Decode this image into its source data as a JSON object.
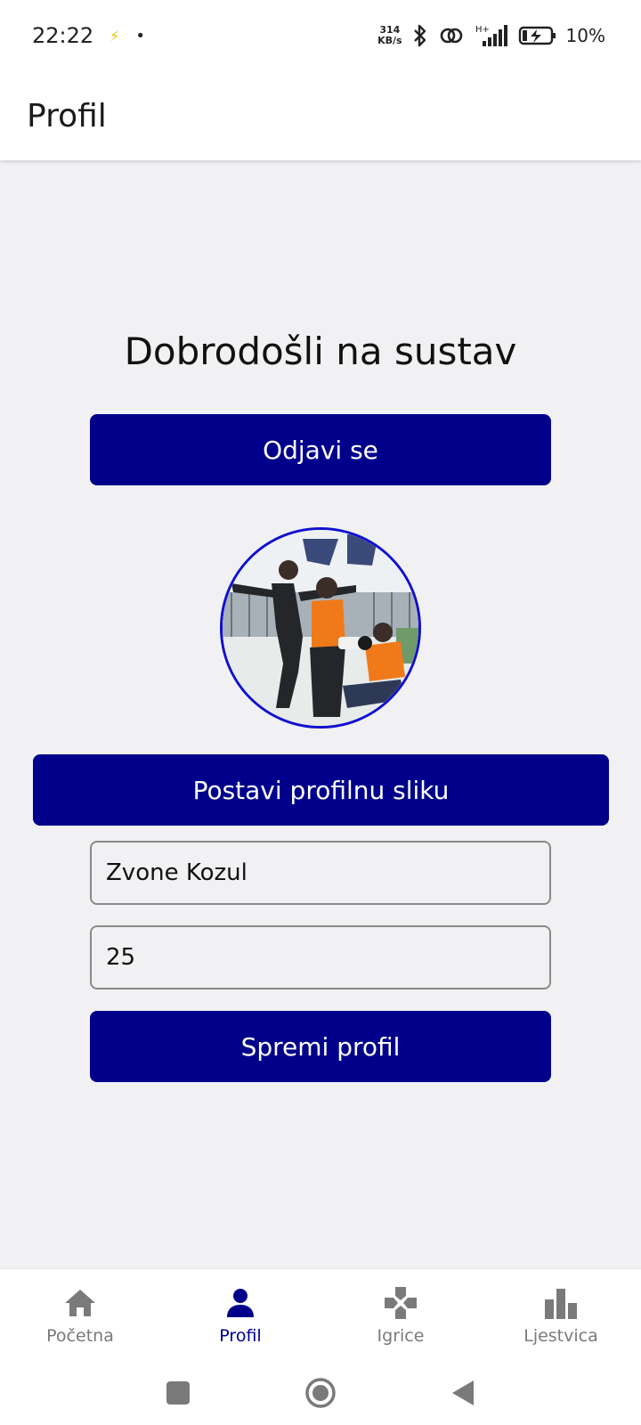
{
  "status_bar": {
    "time": "22:22",
    "dot": "•",
    "speed_value": "314",
    "speed_unit": "KB/s",
    "network_label": "H+",
    "battery_percent": "10%"
  },
  "app_bar": {
    "title": "Profil"
  },
  "main": {
    "welcome": "Dobrodošli na sustav",
    "logout_label": "Odjavi se",
    "set_photo_label": "Postavi profilnu sliku",
    "name_value": "Zvone Kozul",
    "age_value": "25",
    "save_label": "Spremi profil"
  },
  "bottom_nav": {
    "items": [
      {
        "label": "Početna",
        "icon": "home-icon",
        "active": false
      },
      {
        "label": "Profil",
        "icon": "person-icon",
        "active": true
      },
      {
        "label": "Igrice",
        "icon": "gamepad-icon",
        "active": false
      },
      {
        "label": "Ljestvica",
        "icon": "bar-chart-icon",
        "active": false
      }
    ]
  },
  "colors": {
    "primary": "#00008b",
    "background": "#f1f1f3",
    "inactive": "#7a7a7a",
    "avatar_border": "#1010d0"
  }
}
